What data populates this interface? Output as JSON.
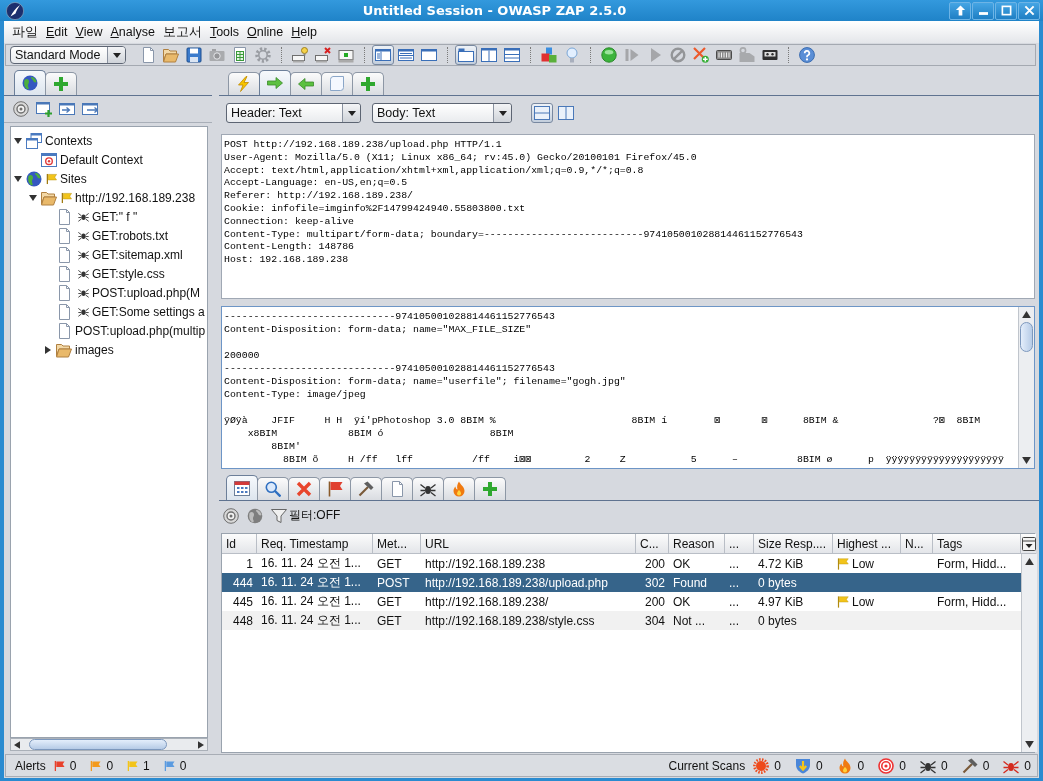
{
  "window": {
    "title": "Untitled Session - OWASP ZAP 2.5.0"
  },
  "menu": [
    {
      "label": "파일",
      "mnemonic": false
    },
    {
      "label": "Edit",
      "mnemonic": true
    },
    {
      "label": "View",
      "mnemonic": true
    },
    {
      "label": "Analyse",
      "mnemonic": true
    },
    {
      "label": "보고서",
      "mnemonic": false
    },
    {
      "label": "Tools",
      "mnemonic": true
    },
    {
      "label": "Online",
      "mnemonic": true
    },
    {
      "label": "Help",
      "mnemonic": true
    }
  ],
  "toolbar": {
    "mode": "Standard Mode",
    "groups": [
      [
        {
          "kind": "page",
          "pressed": false,
          "disabled": false
        },
        {
          "kind": "folder",
          "pressed": false,
          "disabled": false
        },
        {
          "kind": "floppy",
          "pressed": false,
          "disabled": false
        },
        {
          "kind": "camera",
          "pressed": false,
          "disabled": true
        },
        {
          "kind": "page-table",
          "pressed": false,
          "disabled": false
        },
        {
          "kind": "gear",
          "pressed": false,
          "disabled": false
        }
      ],
      [
        {
          "kind": "screen-bulb",
          "pressed": false,
          "disabled": false
        },
        {
          "kind": "screen-x",
          "pressed": false,
          "disabled": false
        },
        {
          "kind": "screen-small",
          "pressed": false,
          "disabled": false
        }
      ],
      [
        {
          "kind": "layout-side",
          "pressed": true,
          "disabled": false
        },
        {
          "kind": "layout-rows",
          "pressed": false,
          "disabled": false
        },
        {
          "kind": "layout-full",
          "pressed": false,
          "disabled": false
        }
      ],
      [
        {
          "kind": "tabs-layout",
          "pressed": true,
          "disabled": false
        },
        {
          "kind": "columns-layout",
          "pressed": false,
          "disabled": false
        },
        {
          "kind": "rows-layout",
          "pressed": false,
          "disabled": false
        }
      ],
      [
        {
          "kind": "blocks",
          "pressed": false,
          "disabled": false
        },
        {
          "kind": "bulb",
          "pressed": false,
          "disabled": false
        }
      ],
      [
        {
          "kind": "ball",
          "pressed": false,
          "disabled": false
        },
        {
          "kind": "step",
          "pressed": false,
          "disabled": true
        },
        {
          "kind": "play",
          "pressed": false,
          "disabled": true
        },
        {
          "kind": "stop",
          "pressed": false,
          "disabled": true
        },
        {
          "kind": "x-plus",
          "pressed": false,
          "disabled": false
        },
        {
          "kind": "keyboard",
          "pressed": false,
          "disabled": false
        },
        {
          "kind": "tag",
          "pressed": false,
          "disabled": true
        },
        {
          "kind": "cassette",
          "pressed": false,
          "disabled": false
        }
      ],
      [
        {
          "kind": "help",
          "pressed": false,
          "disabled": false
        }
      ]
    ]
  },
  "sites_panel": {
    "tabs": [
      {
        "kind": "globe",
        "selected": true
      },
      {
        "kind": "plus",
        "selected": false
      }
    ],
    "tree": [
      {
        "kind": "contexts",
        "label": "Contexts",
        "expanded": true,
        "flagged": false,
        "spidered": false,
        "children": [
          {
            "kind": "context",
            "label": "Default Context",
            "flagged": false,
            "spidered": false
          }
        ]
      },
      {
        "kind": "globe",
        "label": "Sites",
        "expanded": true,
        "flagged": true,
        "spidered": false,
        "children": [
          {
            "kind": "folder",
            "label": "http://192.168.189.238",
            "expanded": true,
            "flagged": true,
            "spidered": false,
            "children": [
              {
                "kind": "page",
                "label": "GET:\" f \"",
                "flagged": false,
                "spidered": true
              },
              {
                "kind": "page",
                "label": "GET:robots.txt",
                "flagged": false,
                "spidered": true
              },
              {
                "kind": "page",
                "label": "GET:sitemap.xml",
                "flagged": false,
                "spidered": true
              },
              {
                "kind": "page",
                "label": "GET:style.css",
                "flagged": false,
                "spidered": true
              },
              {
                "kind": "page",
                "label": "POST:upload.php(M",
                "flagged": false,
                "spidered": true
              },
              {
                "kind": "page",
                "label": "GET:Some settings a",
                "flagged": false,
                "spidered": true
              },
              {
                "kind": "page",
                "label": "POST:upload.php(multip",
                "flagged": false,
                "spidered": false
              },
              {
                "kind": "folder",
                "label": "images",
                "expanded": false,
                "flagged": false,
                "spidered": false
              }
            ]
          }
        ]
      }
    ]
  },
  "request_panel": {
    "tabs": [
      {
        "kind": "lightning",
        "selected": false
      },
      {
        "kind": "arrow-right",
        "selected": true
      },
      {
        "kind": "arrow-left",
        "selected": false
      },
      {
        "kind": "scroll",
        "selected": false
      },
      {
        "kind": "plus",
        "selected": false
      }
    ],
    "header_view": "Header: Text",
    "body_view": "Body: Text",
    "layout_buttons": [
      {
        "kind": "split-rows",
        "pressed": true
      },
      {
        "kind": "split-columns",
        "pressed": false
      }
    ],
    "header_lines": [
      "POST http://192.168.189.238/upload.php HTTP/1.1",
      "User-Agent: Mozilla/5.0 (X11; Linux x86_64; rv:45.0) Gecko/20100101 Firefox/45.0",
      "Accept: text/html,application/xhtml+xml,application/xml;q=0.9,*/*;q=0.8",
      "Accept-Language: en-US,en;q=0.5",
      "Referer: http://192.168.189.238/",
      "Cookie: infofile=imginfo%2F14799424940.55803800.txt",
      "Connection: keep-alive",
      "Content-Type: multipart/form-data; boundary=---------------------------974105001028814461152776543",
      "Content-Length: 148786",
      "Host: 192.168.189.238"
    ],
    "body_blocks": [
      {
        "lines": [
          "-----------------------------974105001028814461152776543",
          "Content-Disposition: form-data; name=\"MAX_FILE_SIZE\""
        ]
      },
      {
        "lines": [
          "200000",
          "-----------------------------974105001028814461152776543",
          "Content-Disposition: form-data; name=\"userfile\"; filename=\"gogh.jpg\"",
          "Content-Type: image/jpeg"
        ]
      },
      {
        "lines": [
          "ÿØÿà    JFIF     H H  ÿí'pPhotoshop 3.0 8BIM %                       8BIM í        ⊠       ⊠      8BIM &                ?⊠  8BIM",
          "    x8BIM            8BIM ó                  8BIM",
          "        8BIM'",
          "          8BIM õ     H /ff   lff          /ff    i⊠⊠         2     Z           5      –          8BIM ø      p  ÿÿÿÿÿÿÿÿÿÿÿÿÿÿÿÿÿÿÿÿ"
        ]
      }
    ]
  },
  "history_panel": {
    "tabs": [
      {
        "kind": "history",
        "selected": true
      },
      {
        "kind": "search",
        "selected": false
      },
      {
        "kind": "cross",
        "selected": false
      },
      {
        "kind": "flag",
        "selected": false
      },
      {
        "kind": "hammer",
        "selected": false
      },
      {
        "kind": "page",
        "selected": false
      },
      {
        "kind": "spider",
        "selected": false
      },
      {
        "kind": "fire",
        "selected": false
      },
      {
        "kind": "plus",
        "selected": false
      }
    ],
    "filter": "필터:OFF",
    "table": {
      "columns": [
        "Id",
        "Req. Timestamp",
        "Met...",
        "URL",
        "C...",
        "Reason",
        "...",
        "Size Resp....",
        "Highest ...",
        "N...",
        "Tags"
      ],
      "rows": [
        {
          "id": "1",
          "timestamp": "16. 11. 24 오전 1...",
          "method": "GET",
          "url": "http://192.168.189.238",
          "code": "200",
          "reason": "OK",
          "column_7": "...",
          "size": "4.72 KiB",
          "highest_alert": "Low",
          "tags": "Form, Hidd...",
          "selected": false
        },
        {
          "id": "444",
          "timestamp": "16. 11. 24 오전 1...",
          "method": "POST",
          "url": "http://192.168.189.238/upload.php",
          "code": "302",
          "reason": "Found",
          "column_7": "...",
          "size": "0 bytes",
          "selected": true
        },
        {
          "id": "445",
          "timestamp": "16. 11. 24 오전 1...",
          "method": "GET",
          "url": "http://192.168.189.238/",
          "code": "200",
          "reason": "OK",
          "column_7": "...",
          "size": "4.97 KiB",
          "highest_alert": "Low",
          "tags": "Form, Hidd...",
          "selected": false
        },
        {
          "id": "448",
          "timestamp": "16. 11. 24 오전 1...",
          "method": "GET",
          "url": "http://192.168.189.238/style.css",
          "code": "304",
          "reason": "Not ...",
          "column_7": "...",
          "size": "0 bytes",
          "selected": false
        }
      ]
    }
  },
  "status_bar": {
    "alerts_label": "Alerts",
    "alerts": [
      {
        "color": "#e8412c",
        "count": "0"
      },
      {
        "color": "#f39a1c",
        "count": "0"
      },
      {
        "color": "#f2c41a",
        "count": "1"
      },
      {
        "color": "#5b9be0",
        "count": "0"
      }
    ],
    "scans_label": "Current Scans",
    "scans": [
      {
        "kind": "burst",
        "count": "0"
      },
      {
        "kind": "shield",
        "count": "0"
      },
      {
        "kind": "fire",
        "count": "0"
      },
      {
        "kind": "target",
        "count": "0"
      },
      {
        "kind": "spider",
        "count": "0"
      },
      {
        "kind": "hammer",
        "count": "0"
      },
      {
        "kind": "spider-red",
        "count": "0"
      }
    ]
  }
}
